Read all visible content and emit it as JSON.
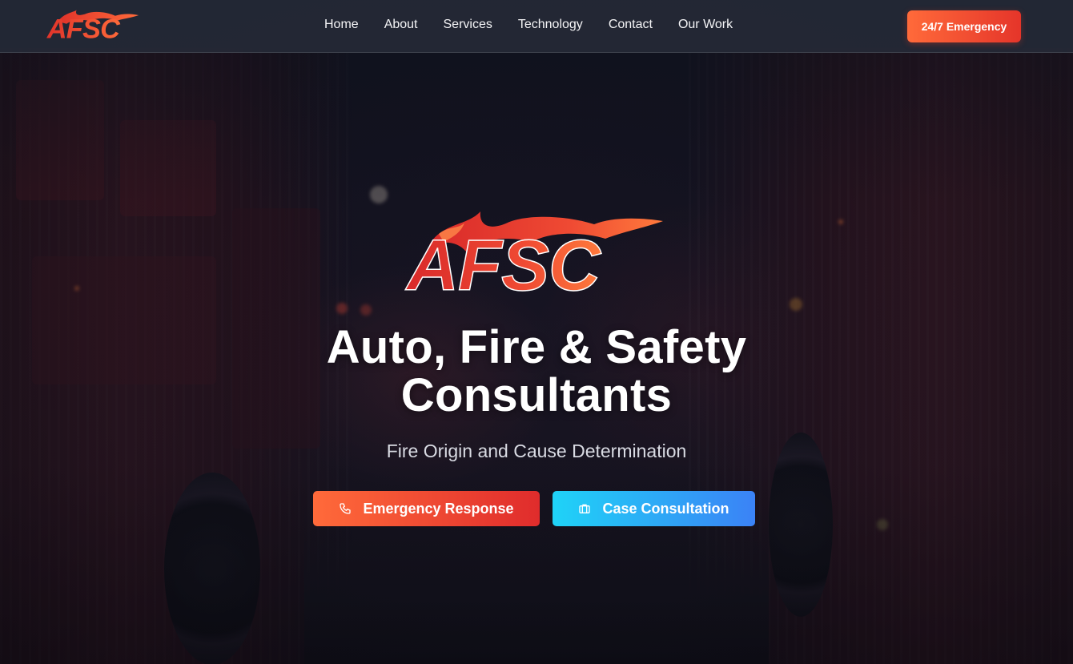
{
  "brand": {
    "logo_text": "AFSC",
    "colors": {
      "accent_orange": "#ff6a3a",
      "accent_red": "#e02c2c",
      "accent_cyan": "#1fd3f7",
      "accent_blue": "#3b82f6",
      "navbar_bg": "#262a38"
    }
  },
  "nav": {
    "links": [
      {
        "label": "Home"
      },
      {
        "label": "About"
      },
      {
        "label": "Services"
      },
      {
        "label": "Technology"
      },
      {
        "label": "Contact"
      },
      {
        "label": "Our Work"
      }
    ],
    "emergency_label": "24/7 Emergency"
  },
  "hero": {
    "title_line1": "Auto, Fire & Safety",
    "title_line2": "Consultants",
    "subtitle": "Fire Origin and Cause Determination",
    "buttons": [
      {
        "label": "Emergency Response",
        "icon": "phone-icon"
      },
      {
        "label": "Case Consultation",
        "icon": "briefcase-icon"
      }
    ]
  }
}
